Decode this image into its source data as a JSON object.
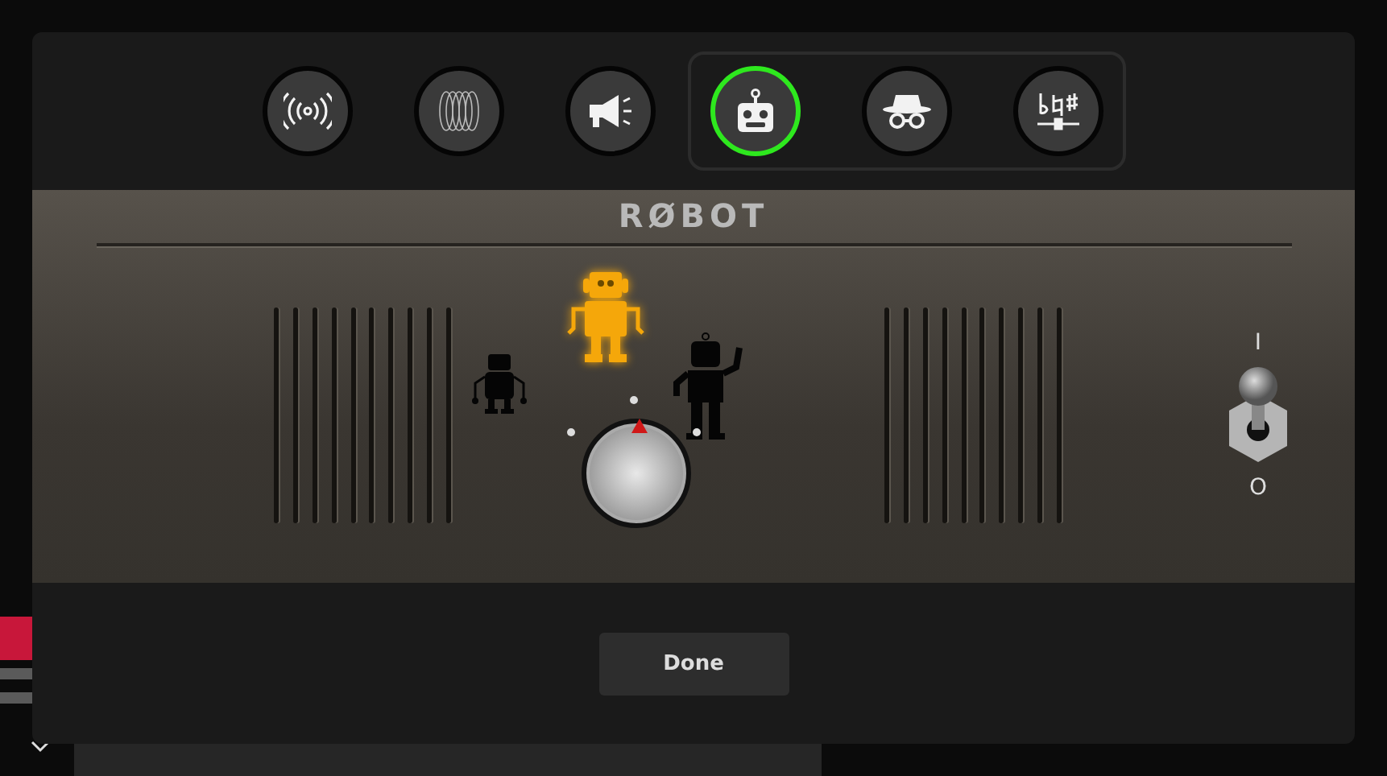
{
  "effects": [
    {
      "kind": "waves",
      "selected": false
    },
    {
      "kind": "mesh",
      "selected": false
    },
    {
      "kind": "megaphone",
      "selected": false
    }
  ],
  "voice_effects": [
    {
      "kind": "robot",
      "selected": true
    },
    {
      "kind": "spy",
      "selected": false
    },
    {
      "kind": "pitch",
      "selected": false
    }
  ],
  "panel": {
    "title": "RØBOT",
    "voices": [
      {
        "kind": "small",
        "selected": false
      },
      {
        "kind": "classic",
        "selected": true
      },
      {
        "kind": "tall",
        "selected": false
      }
    ],
    "knob": {
      "level": 0.5
    },
    "switch": {
      "on": true,
      "label_on": "I",
      "label_off": "O"
    }
  },
  "done_button": "Done"
}
